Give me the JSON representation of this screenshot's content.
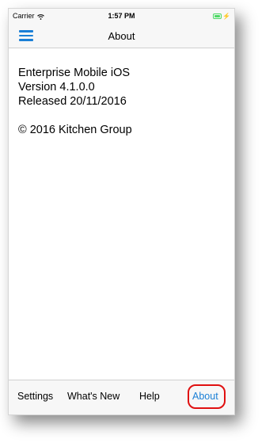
{
  "status_bar": {
    "carrier": "Carrier",
    "time": "1:57 PM",
    "wifi_icon": "wifi-icon",
    "battery_icon": "battery-icon",
    "battery_level": 1.0
  },
  "nav_bar": {
    "title": "About",
    "menu_icon": "hamburger-menu-icon"
  },
  "content": {
    "app_name": "Enterprise Mobile iOS",
    "version": "Version 4.1.0.0",
    "released": "Released 20/11/2016",
    "copyright": "© 2016 Kitchen Group"
  },
  "tab_bar": {
    "tabs": [
      {
        "label": "Settings",
        "active": false
      },
      {
        "label": "What's New",
        "active": false
      },
      {
        "label": "Help",
        "active": false
      },
      {
        "label": "About",
        "active": true
      }
    ]
  },
  "colors": {
    "accent": "#1a7fd6",
    "highlight": "#e01010",
    "battery": "#4cd964"
  }
}
